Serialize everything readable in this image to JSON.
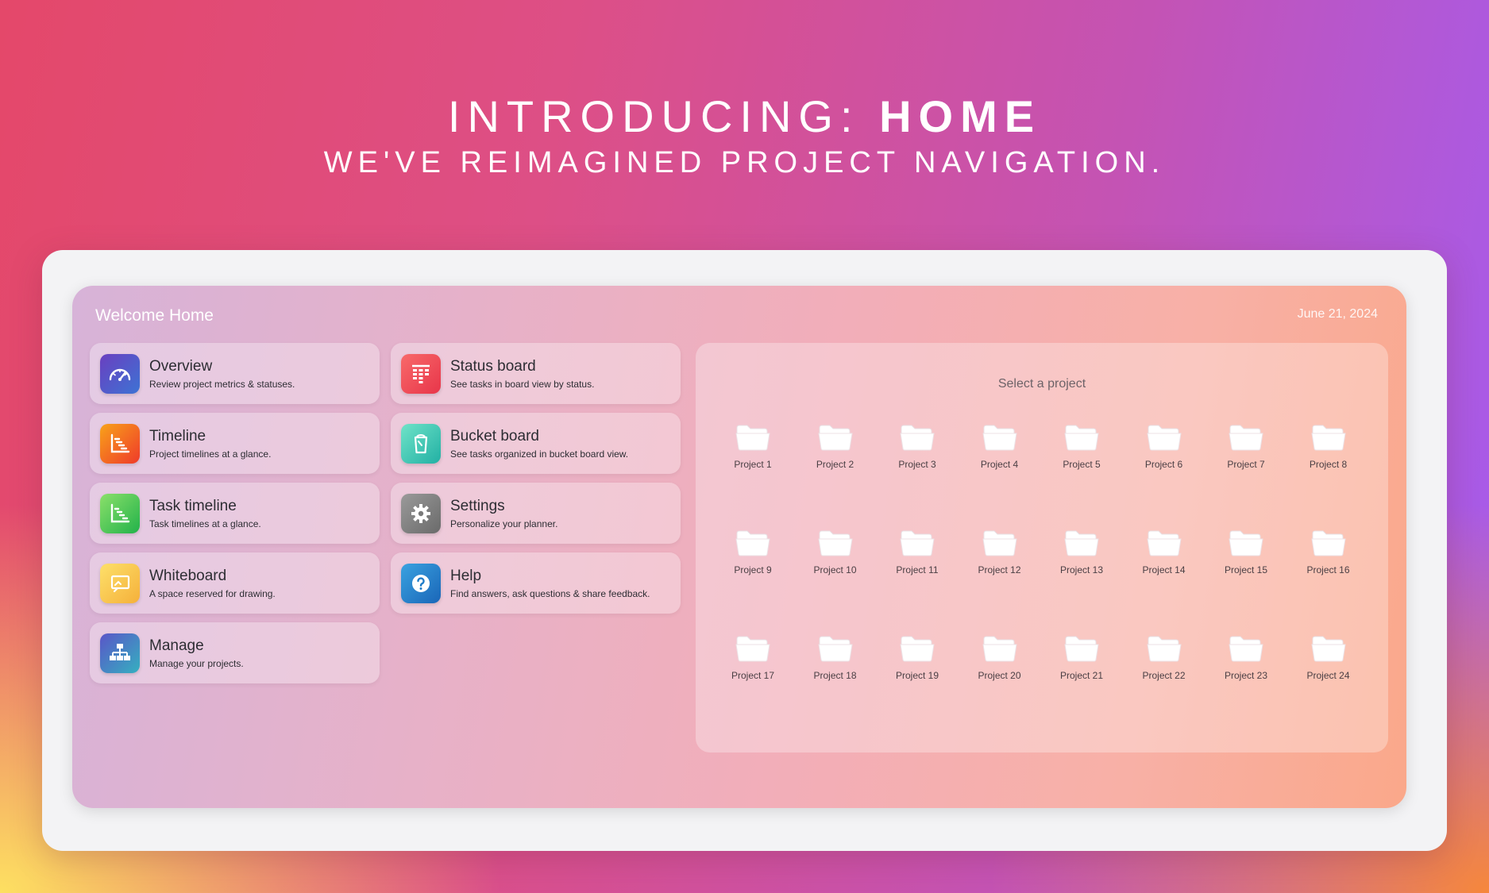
{
  "hero": {
    "title_prefix": "INTRODUCING: ",
    "title_strong": "HOME",
    "subtitle": "WE'VE REIMAGINED PROJECT NAVIGATION."
  },
  "app": {
    "welcome": "Welcome Home",
    "date": "June 21, 2024"
  },
  "nav_left": [
    {
      "title": "Overview",
      "desc": "Review project metrics & statuses.",
      "icon": "gauge-icon"
    },
    {
      "title": "Timeline",
      "desc": "Project timelines at a glance.",
      "icon": "timeline-chart-icon"
    },
    {
      "title": "Task timeline",
      "desc": "Task timelines at a glance.",
      "icon": "task-timeline-icon"
    },
    {
      "title": "Whiteboard",
      "desc": "A space reserved for drawing.",
      "icon": "whiteboard-icon"
    },
    {
      "title": "Manage",
      "desc": "Manage your projects.",
      "icon": "org-chart-icon"
    }
  ],
  "nav_right": [
    {
      "title": "Status board",
      "desc": "See tasks in board view by status.",
      "icon": "board-icon"
    },
    {
      "title": "Bucket board",
      "desc": "See tasks organized in bucket board view.",
      "icon": "bucket-icon"
    },
    {
      "title": "Settings",
      "desc": "Personalize your planner.",
      "icon": "gear-icon"
    },
    {
      "title": "Help",
      "desc": "Find answers, ask questions & share feedback.",
      "icon": "help-icon"
    }
  ],
  "projects_panel": {
    "title": "Select a project",
    "projects": [
      "Project 1",
      "Project 2",
      "Project 3",
      "Project 4",
      "Project 5",
      "Project 6",
      "Project 7",
      "Project 8",
      "Project 9",
      "Project 10",
      "Project 11",
      "Project 12",
      "Project 13",
      "Project 14",
      "Project 15",
      "Project 16",
      "Project 17",
      "Project 18",
      "Project 19",
      "Project 20",
      "Project 21",
      "Project 22",
      "Project 23",
      "Project 24"
    ]
  },
  "colors": {
    "overview": "#4a5bc4",
    "timeline": "#f06a1f",
    "task_timeline": "#3dbb4c",
    "whiteboard": "#f7c53a",
    "manage": "#3d8fc0",
    "status_board": "#ee4452",
    "bucket_board": "#34c4b0",
    "settings": "#7d7d7d",
    "help": "#1f7cc8"
  }
}
